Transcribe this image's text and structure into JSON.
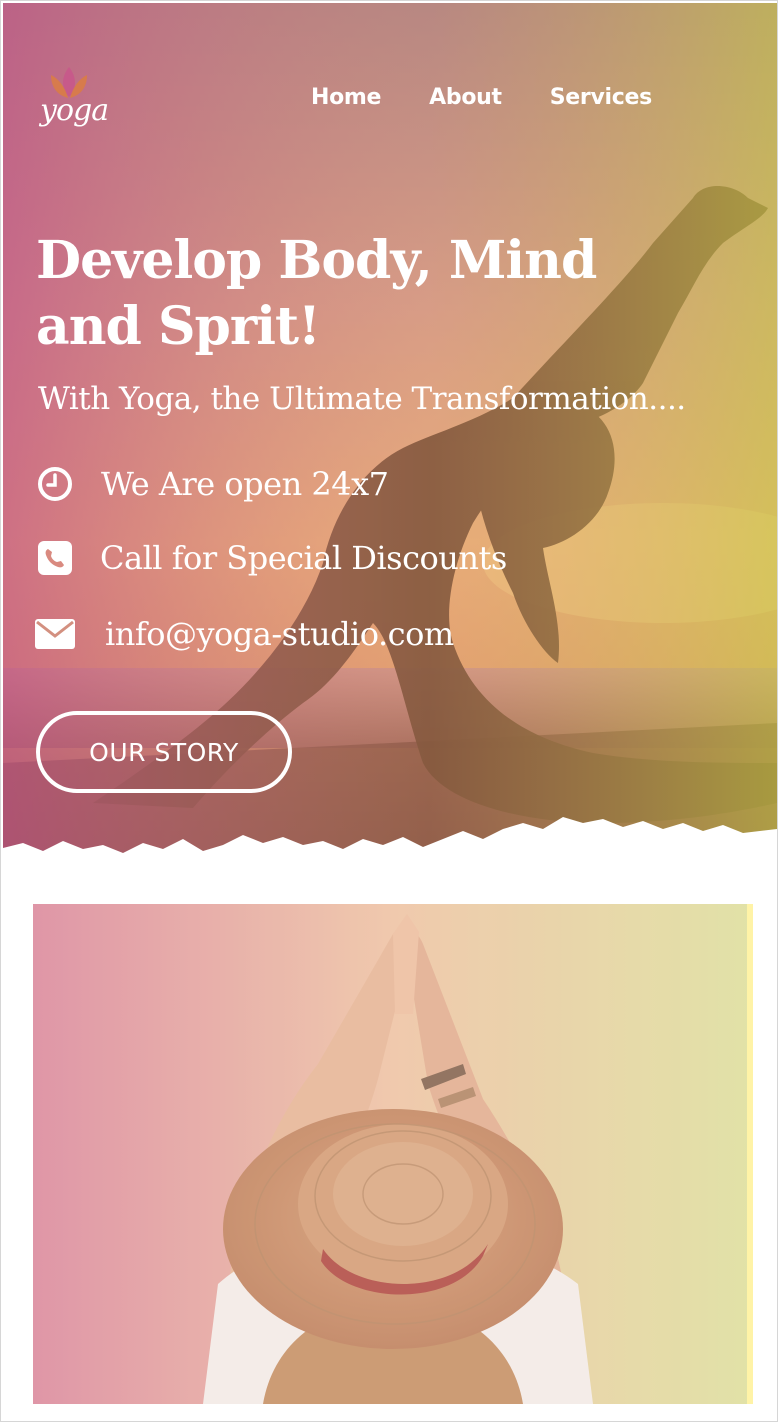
{
  "header": {
    "logo_text": "yoga",
    "nav": [
      "Home",
      "About",
      "Services"
    ]
  },
  "hero": {
    "headline": "Develop Body, Mind and Sprit!",
    "subline": "With Yoga, the Ultimate Transformation....",
    "info": [
      {
        "icon": "clock-icon",
        "text": "We Are open 24x7"
      },
      {
        "icon": "phone-icon",
        "text": "Call for Special Discounts"
      },
      {
        "icon": "envelope-icon",
        "text": "info@yoga-studio.com"
      }
    ],
    "button_label": "OUR STORY"
  },
  "colors": {
    "overlay_left": "#c25a87",
    "overlay_right": "#c8c64d",
    "text": "#ffffff",
    "silhouette": "#5a3420"
  }
}
